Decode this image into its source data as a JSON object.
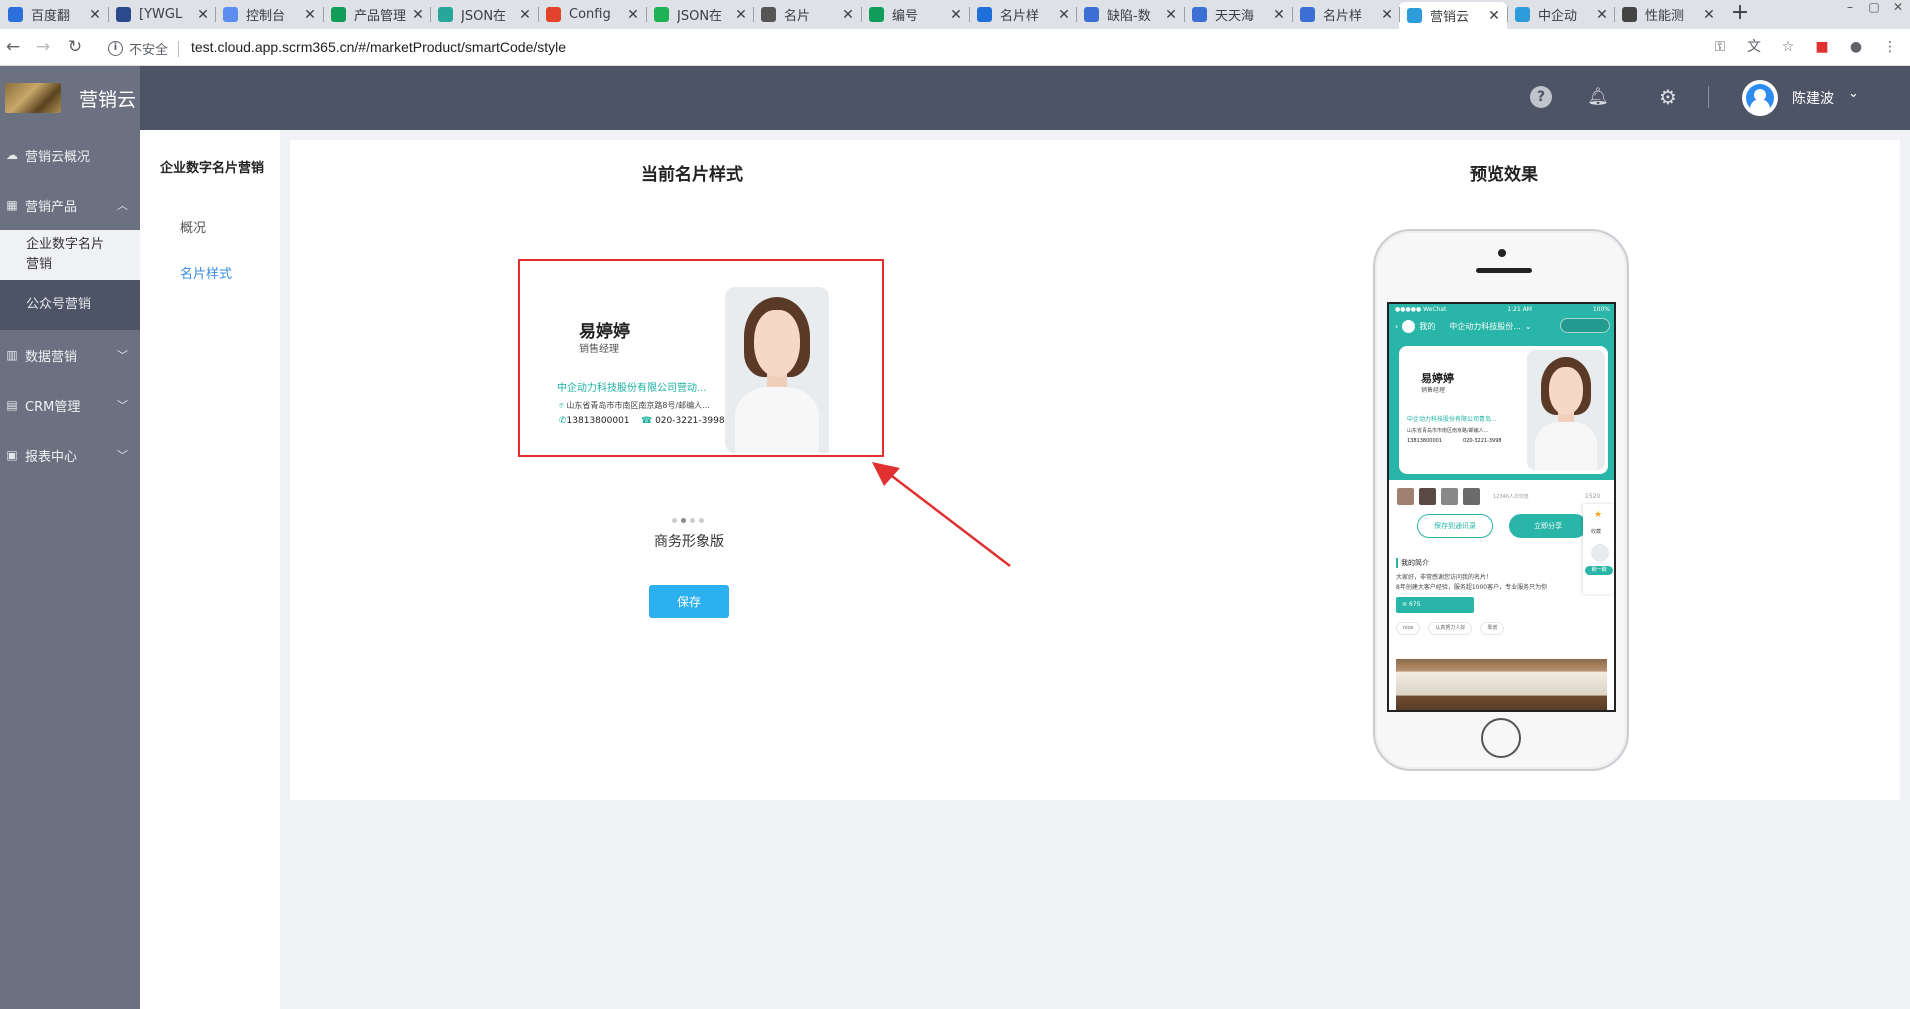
{
  "browser": {
    "tabs": [
      {
        "label": "百度翻",
        "icon": "translate-icon",
        "color": "#2a6fdb"
      },
      {
        "label": "[YWGL",
        "icon": "bug-icon",
        "color": "#2b4a8b"
      },
      {
        "label": "控制台",
        "icon": "console-icon",
        "color": "#5b8def"
      },
      {
        "label": "产品管理",
        "icon": "sheet-icon",
        "color": "#0f9d58"
      },
      {
        "label": "JSON在",
        "icon": "json-icon",
        "color": "#27a69a"
      },
      {
        "label": "Config",
        "icon": "gitlab-icon",
        "color": "#e2432a"
      },
      {
        "label": "JSON在",
        "icon": "json-icon",
        "color": "#1fb155"
      },
      {
        "label": "名片",
        "icon": "globe-icon",
        "color": "#555555"
      },
      {
        "label": "编号",
        "icon": "sheet-icon",
        "color": "#0f9d58"
      },
      {
        "label": "名片样",
        "icon": "doc-icon",
        "color": "#1e6fd9"
      },
      {
        "label": "缺陷-数",
        "icon": "doc-icon",
        "color": "#3b6fd4"
      },
      {
        "label": "天天海",
        "icon": "doc-icon",
        "color": "#3b6fd4"
      },
      {
        "label": "名片样",
        "icon": "doc-icon",
        "color": "#3b6fd4"
      },
      {
        "label": "营销云",
        "icon": "card-icon",
        "color": "#2d9cdb"
      },
      {
        "label": "中企动",
        "icon": "card-icon",
        "color": "#2d9cdb"
      },
      {
        "label": "性能测",
        "icon": "perf-icon",
        "color": "#444444"
      }
    ],
    "active_tab": 13,
    "security": "不安全",
    "url": "test.cloud.app.scrm365.cn/#/marketProduct/smartCode/style"
  },
  "header": {
    "app_name": "营销云",
    "username": "陈建波"
  },
  "sidebar": {
    "items": [
      {
        "label": "营销云概况",
        "icon": "cloud-icon"
      },
      {
        "label": "营销产品",
        "icon": "grid-icon",
        "expanded": true
      },
      {
        "label": "企业数字名片营销"
      },
      {
        "label": "公众号营销"
      },
      {
        "label": "数据营销",
        "icon": "chart-icon"
      },
      {
        "label": "CRM管理",
        "icon": "crm-icon"
      },
      {
        "label": "报表中心",
        "icon": "report-icon"
      }
    ]
  },
  "subnav": {
    "title": "企业数字名片营销",
    "links": [
      "概况",
      "名片样式"
    ],
    "active": "名片样式"
  },
  "content": {
    "current_title": "当前名片样式",
    "preview_title": "预览效果",
    "card": {
      "name": "易婷婷",
      "position": "销售经理",
      "company": "中企动力科技股份有限公司营动...",
      "address": "山东省青岛市市南区南京路8号/邮编人...",
      "mobile": "13813800001",
      "tel": "020-3221-3998"
    },
    "style_name": "商务形象版",
    "save_label": "保存"
  },
  "phone": {
    "status_left": "●●●●● WeChat",
    "status_time": "1:21 AM",
    "status_right": "100%",
    "nav_back": "我的",
    "nav_title": "中企动力科技股份...",
    "card_company": "中企动力科技股份有限公司青岛...",
    "card_address": "山东省青岛市市南区南京路/邮编人...",
    "visitors_text": "12346人次浏览",
    "likes": "1520",
    "save_contact": "保存到通讯录",
    "share": "立即分享",
    "fav_label": "收藏",
    "fav_tag": "聊一聊",
    "intro_title": "我的简介",
    "intro_line1": "大家好，非常感谢您访问我的名片！",
    "intro_line2": "8年创建大客户经验，服务超1000客户，专业服务只为你",
    "voice": "67S",
    "tags": [
      "nice",
      "认真努力人好",
      "靠谱"
    ]
  }
}
